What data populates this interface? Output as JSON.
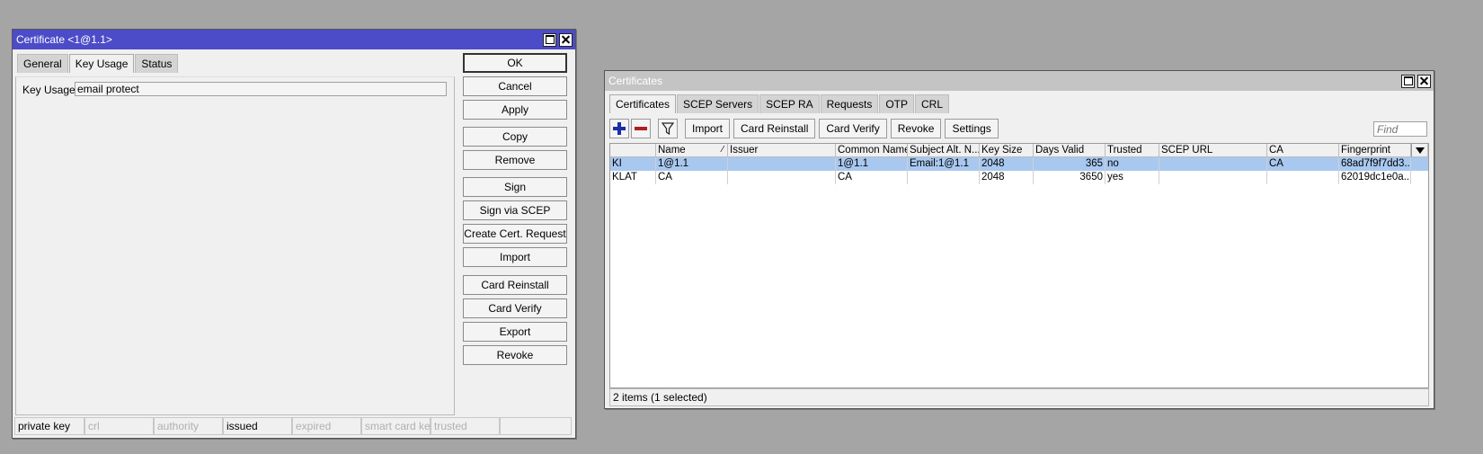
{
  "cert_window": {
    "title": "Certificate <1@1.1>",
    "tabs": [
      {
        "label": "General"
      },
      {
        "label": "Key Usage"
      },
      {
        "label": "Status"
      }
    ],
    "key_usage": {
      "label": "Key Usage:",
      "value": "email protect"
    },
    "buttons": {
      "ok": "OK",
      "cancel": "Cancel",
      "apply": "Apply",
      "copy": "Copy",
      "remove": "Remove",
      "sign": "Sign",
      "sign_scep": "Sign via SCEP",
      "create_request": "Create Cert. Request",
      "import": "Import",
      "card_reinstall": "Card Reinstall",
      "card_verify": "Card Verify",
      "export": "Export",
      "revoke": "Revoke"
    },
    "status_flags": [
      {
        "label": "private key",
        "active": true
      },
      {
        "label": "crl",
        "active": false
      },
      {
        "label": "authority",
        "active": false
      },
      {
        "label": "issued",
        "active": true
      },
      {
        "label": "expired",
        "active": false
      },
      {
        "label": "smart card key",
        "active": false
      },
      {
        "label": "trusted",
        "active": false
      },
      {
        "label": "",
        "active": false
      }
    ]
  },
  "list_window": {
    "title": "Certificates",
    "tabs": [
      {
        "label": "Certificates"
      },
      {
        "label": "SCEP Servers"
      },
      {
        "label": "SCEP RA"
      },
      {
        "label": "Requests"
      },
      {
        "label": "OTP"
      },
      {
        "label": "CRL"
      }
    ],
    "toolbar": {
      "import": "Import",
      "card_reinstall": "Card Reinstall",
      "card_verify": "Card Verify",
      "revoke": "Revoke",
      "settings": "Settings",
      "find_placeholder": "Find"
    },
    "columns": [
      "",
      "Name",
      "Issuer",
      "Common Name",
      "Subject Alt. N...",
      "Key Size",
      "Days Valid",
      "Trusted",
      "SCEP URL",
      "CA",
      "Fingerprint"
    ],
    "rows": [
      {
        "flags": "KI",
        "name": "1@1.1",
        "issuer": "",
        "common_name": "1@1.1",
        "subject_alt": "Email:1@1.1",
        "key_size": "2048",
        "days_valid": "365",
        "trusted": "no",
        "scep_url": "",
        "ca": "CA",
        "fingerprint": "68ad7f9f7dd3...",
        "selected": true
      },
      {
        "flags": "KLAT",
        "name": "CA",
        "issuer": "",
        "common_name": "CA",
        "subject_alt": "",
        "key_size": "2048",
        "days_valid": "3650",
        "trusted": "yes",
        "scep_url": "",
        "ca": "",
        "fingerprint": "62019dc1e0a...",
        "selected": false
      }
    ],
    "status": "2 items (1 selected)"
  }
}
